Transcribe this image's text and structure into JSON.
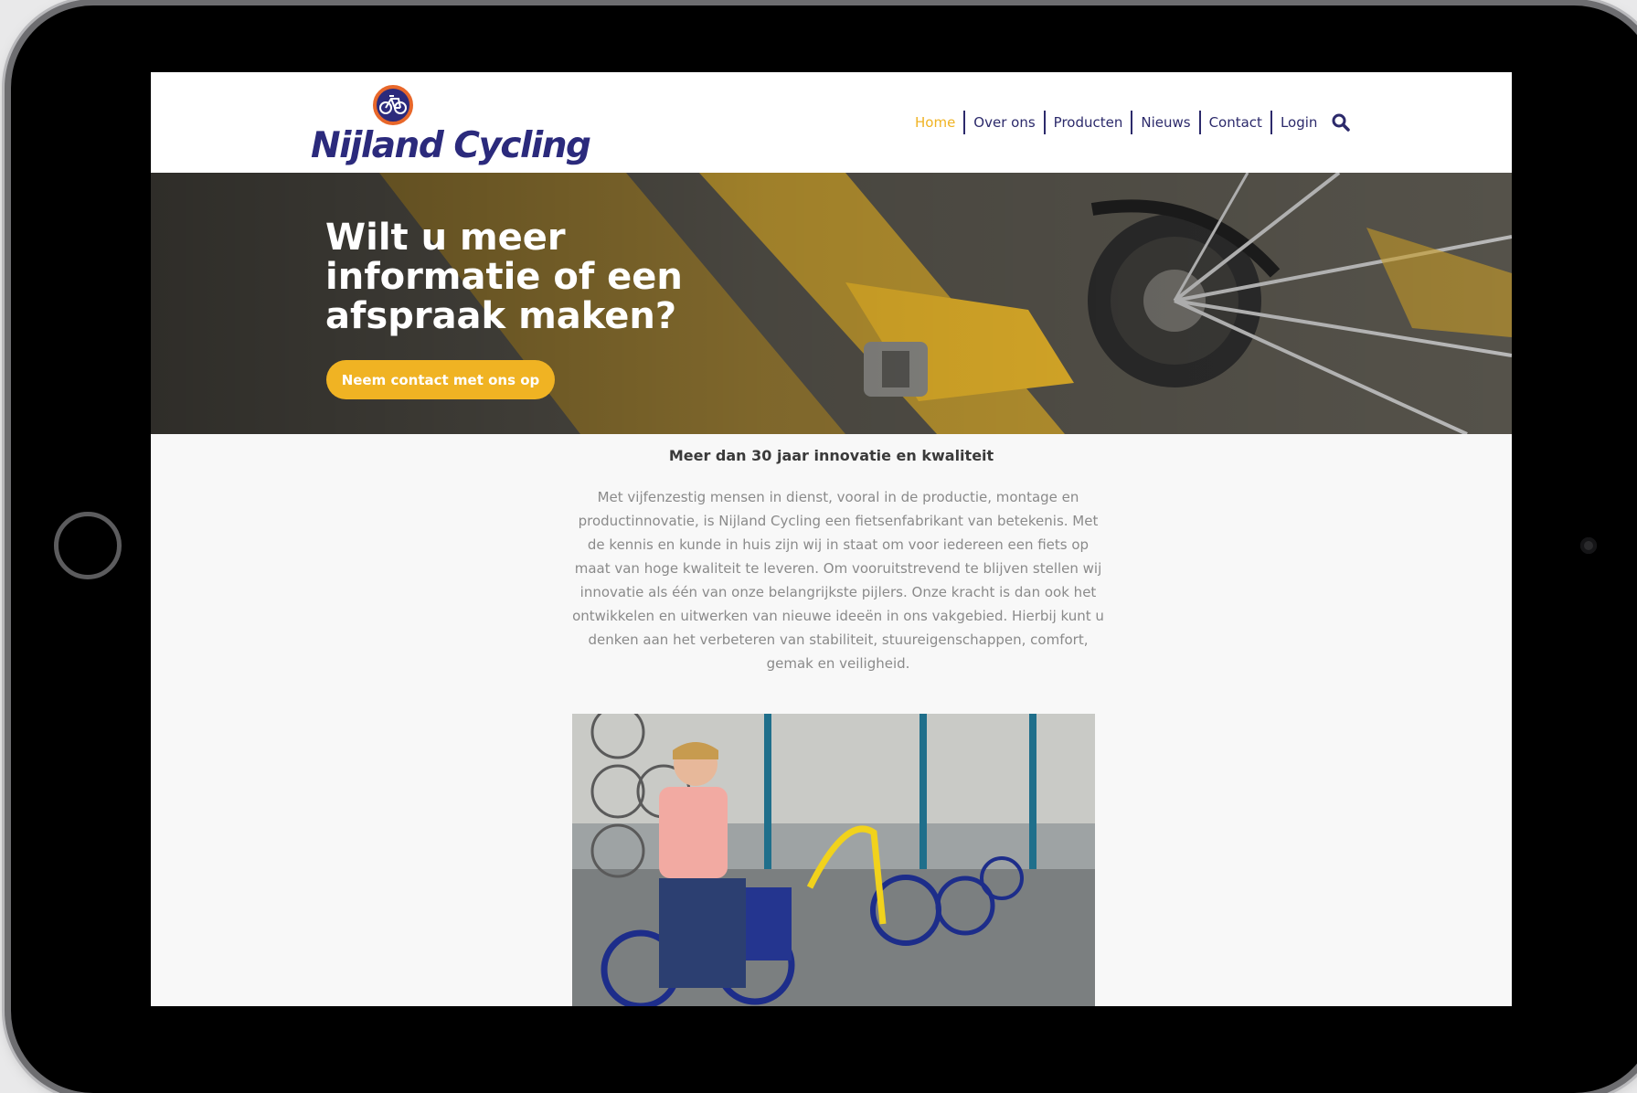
{
  "brand": {
    "name": "Nijland Cycling",
    "navy": "#2b2a7c",
    "accent": "#f0b323",
    "logo_ring": "#e8672a"
  },
  "nav": {
    "items": [
      {
        "label": "Home",
        "active": true
      },
      {
        "label": "Over ons"
      },
      {
        "label": "Producten"
      },
      {
        "label": "Nieuws"
      },
      {
        "label": "Contact"
      },
      {
        "label": "Login"
      }
    ],
    "search_icon": "search-icon"
  },
  "hero": {
    "title": "Wilt u meer informatie of een afspraak maken?",
    "button_label": "Neem contact met ons op"
  },
  "intro": {
    "title": "Meer dan 30 jaar innovatie en kwaliteit",
    "body": "Met vijfenzestig mensen in dienst, vooral in de productie, montage en productinnovatie, is Nijland Cycling een fietsenfabrikant van betekenis. Met de kennis en kunde in huis zijn wij in staat om voor iedereen een fiets op maat van hoge kwaliteit te leveren. Om vooruitstrevend te blijven stellen wij innovatie als één van onze belangrijkste pijlers. Onze kracht is dan ook het ontwikkelen en uitwerken van nieuwe ideeën in ons vakgebied. Hierbij kunt u denken aan het verbeteren van stabiliteit, stuureigenschappen, comfort, gemak en veiligheid."
  }
}
